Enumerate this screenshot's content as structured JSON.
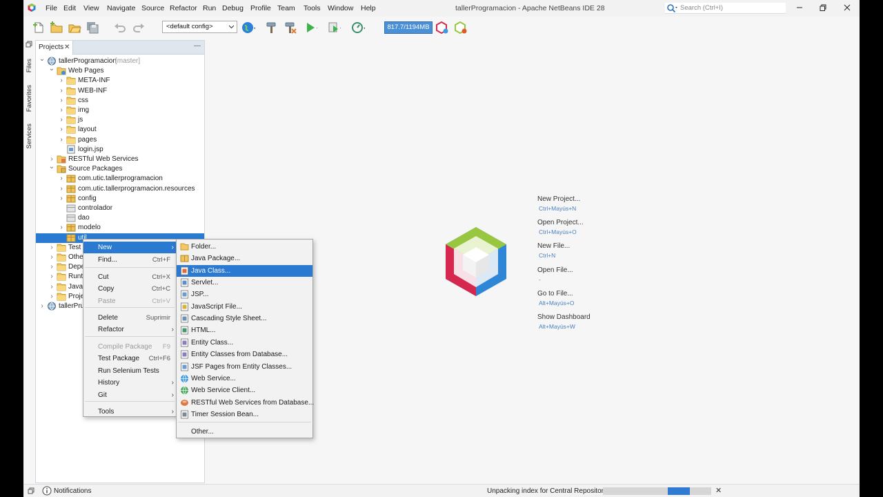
{
  "window": {
    "title": "tallerProgramacion - Apache NetBeans IDE 28",
    "menu": [
      "File",
      "Edit",
      "View",
      "Navigate",
      "Source",
      "Refactor",
      "Run",
      "Debug",
      "Profile",
      "Team",
      "Tools",
      "Window",
      "Help"
    ],
    "search_placeholder": "Search (Ctrl+I)"
  },
  "toolbar": {
    "config": "<default config>",
    "memory": "817.7/1194MB"
  },
  "side_tabs": [
    "Files",
    "Favorites",
    "Services"
  ],
  "projects": {
    "tab_label": "Projects",
    "close_glyph": "✕",
    "minimize_glyph": "—",
    "tree": [
      {
        "label": "tallerProgramacion",
        "branch": "[master]",
        "icon": "project-icon"
      },
      {
        "label": "Web Pages",
        "icon": "web-pages-icon"
      },
      {
        "label": "META-INF",
        "icon": "folder-icon"
      },
      {
        "label": "WEB-INF",
        "icon": "folder-icon"
      },
      {
        "label": "css",
        "icon": "folder-icon"
      },
      {
        "label": "img",
        "icon": "folder-icon"
      },
      {
        "label": "js",
        "icon": "folder-icon"
      },
      {
        "label": "layout",
        "icon": "folder-icon"
      },
      {
        "label": "pages",
        "icon": "folder-icon"
      },
      {
        "label": "login.jsp",
        "icon": "jsp-file-icon"
      },
      {
        "label": "RESTful Web Services",
        "icon": "rest-services-icon"
      },
      {
        "label": "Source Packages",
        "icon": "source-packages-icon"
      },
      {
        "label": "com.utic.tallerprogramacion",
        "icon": "package-icon"
      },
      {
        "label": "com.utic.tallerprogramacion.resources",
        "icon": "package-icon"
      },
      {
        "label": "config",
        "icon": "package-icon"
      },
      {
        "label": "controlador",
        "icon": "empty-package-icon"
      },
      {
        "label": "dao",
        "icon": "empty-package-icon"
      },
      {
        "label": "modelo",
        "icon": "package-icon"
      },
      {
        "label": "util",
        "icon": "package-icon"
      },
      {
        "label": "Test",
        "icon": "folder-icon"
      },
      {
        "label": "Othe",
        "icon": "folder-icon"
      },
      {
        "label": "Depe",
        "icon": "folder-icon"
      },
      {
        "label": "Runt",
        "icon": "folder-icon"
      },
      {
        "label": "Java",
        "icon": "folder-icon"
      },
      {
        "label": "Proje",
        "icon": "folder-icon"
      },
      {
        "label": "tallerPru",
        "icon": "project-icon"
      }
    ]
  },
  "context_menu": {
    "items": [
      {
        "label": "New",
        "shortcut": "",
        "submenu": true
      },
      {
        "label": "Find...",
        "shortcut": "Ctrl+F"
      },
      {
        "label": "Cut",
        "shortcut": "Ctrl+X"
      },
      {
        "label": "Copy",
        "shortcut": "Ctrl+C"
      },
      {
        "label": "Paste",
        "shortcut": "Ctrl+V",
        "disabled": true
      },
      {
        "label": "Delete",
        "shortcut": "Suprimir"
      },
      {
        "label": "Refactor",
        "shortcut": "",
        "submenu": true
      },
      {
        "label": "Compile Package",
        "shortcut": "F9",
        "disabled": true
      },
      {
        "label": "Test Package",
        "shortcut": "Ctrl+F6"
      },
      {
        "label": "Run Selenium Tests",
        "shortcut": ""
      },
      {
        "label": "History",
        "shortcut": "",
        "submenu": true
      },
      {
        "label": "Git",
        "shortcut": "",
        "submenu": true
      },
      {
        "label": "Tools",
        "shortcut": "",
        "submenu": true
      }
    ]
  },
  "new_submenu": {
    "items": [
      {
        "label": "Folder...",
        "icon": "folder-icon"
      },
      {
        "label": "Java Package...",
        "icon": "package-icon"
      },
      {
        "label": "Java Class...",
        "icon": "java-class-icon"
      },
      {
        "label": "Servlet...",
        "icon": "servlet-icon"
      },
      {
        "label": "JSP...",
        "icon": "jsp-icon"
      },
      {
        "label": "JavaScript File...",
        "icon": "javascript-file-icon"
      },
      {
        "label": "Cascading Style Sheet...",
        "icon": "css-file-icon"
      },
      {
        "label": "HTML...",
        "icon": "html-file-icon"
      },
      {
        "label": "Entity Class...",
        "icon": "entity-class-icon"
      },
      {
        "label": "Entity Classes from Database...",
        "icon": "entity-classes-db-icon"
      },
      {
        "label": "JSF Pages from Entity Classes...",
        "icon": "jsf-pages-icon"
      },
      {
        "label": "Web Service...",
        "icon": "web-service-icon"
      },
      {
        "label": "Web Service Client...",
        "icon": "web-service-client-icon"
      },
      {
        "label": "RESTful Web Services from Database...",
        "icon": "restful-db-icon"
      },
      {
        "label": "Timer Session Bean...",
        "icon": "timer-bean-icon"
      },
      {
        "label": "Other...",
        "icon": ""
      }
    ]
  },
  "welcome": {
    "links": [
      {
        "label": "New Project...",
        "shortcut": "Ctrl+Mayús+N"
      },
      {
        "label": "Open Project...",
        "shortcut": "Ctrl+Mayús+O"
      },
      {
        "label": "New File...",
        "shortcut": "Ctrl+N"
      },
      {
        "label": "Open File...",
        "shortcut": "-"
      },
      {
        "label": "Go to File...",
        "shortcut": "Alt+Mayús+O"
      },
      {
        "label": "Show Dashboard",
        "shortcut": "Alt+Mayús+W"
      }
    ]
  },
  "statusbar": {
    "notifications": "Notifications",
    "task": "Unpacking index for Central Repository",
    "progress": 0.2,
    "cancel_glyph": "✕"
  }
}
